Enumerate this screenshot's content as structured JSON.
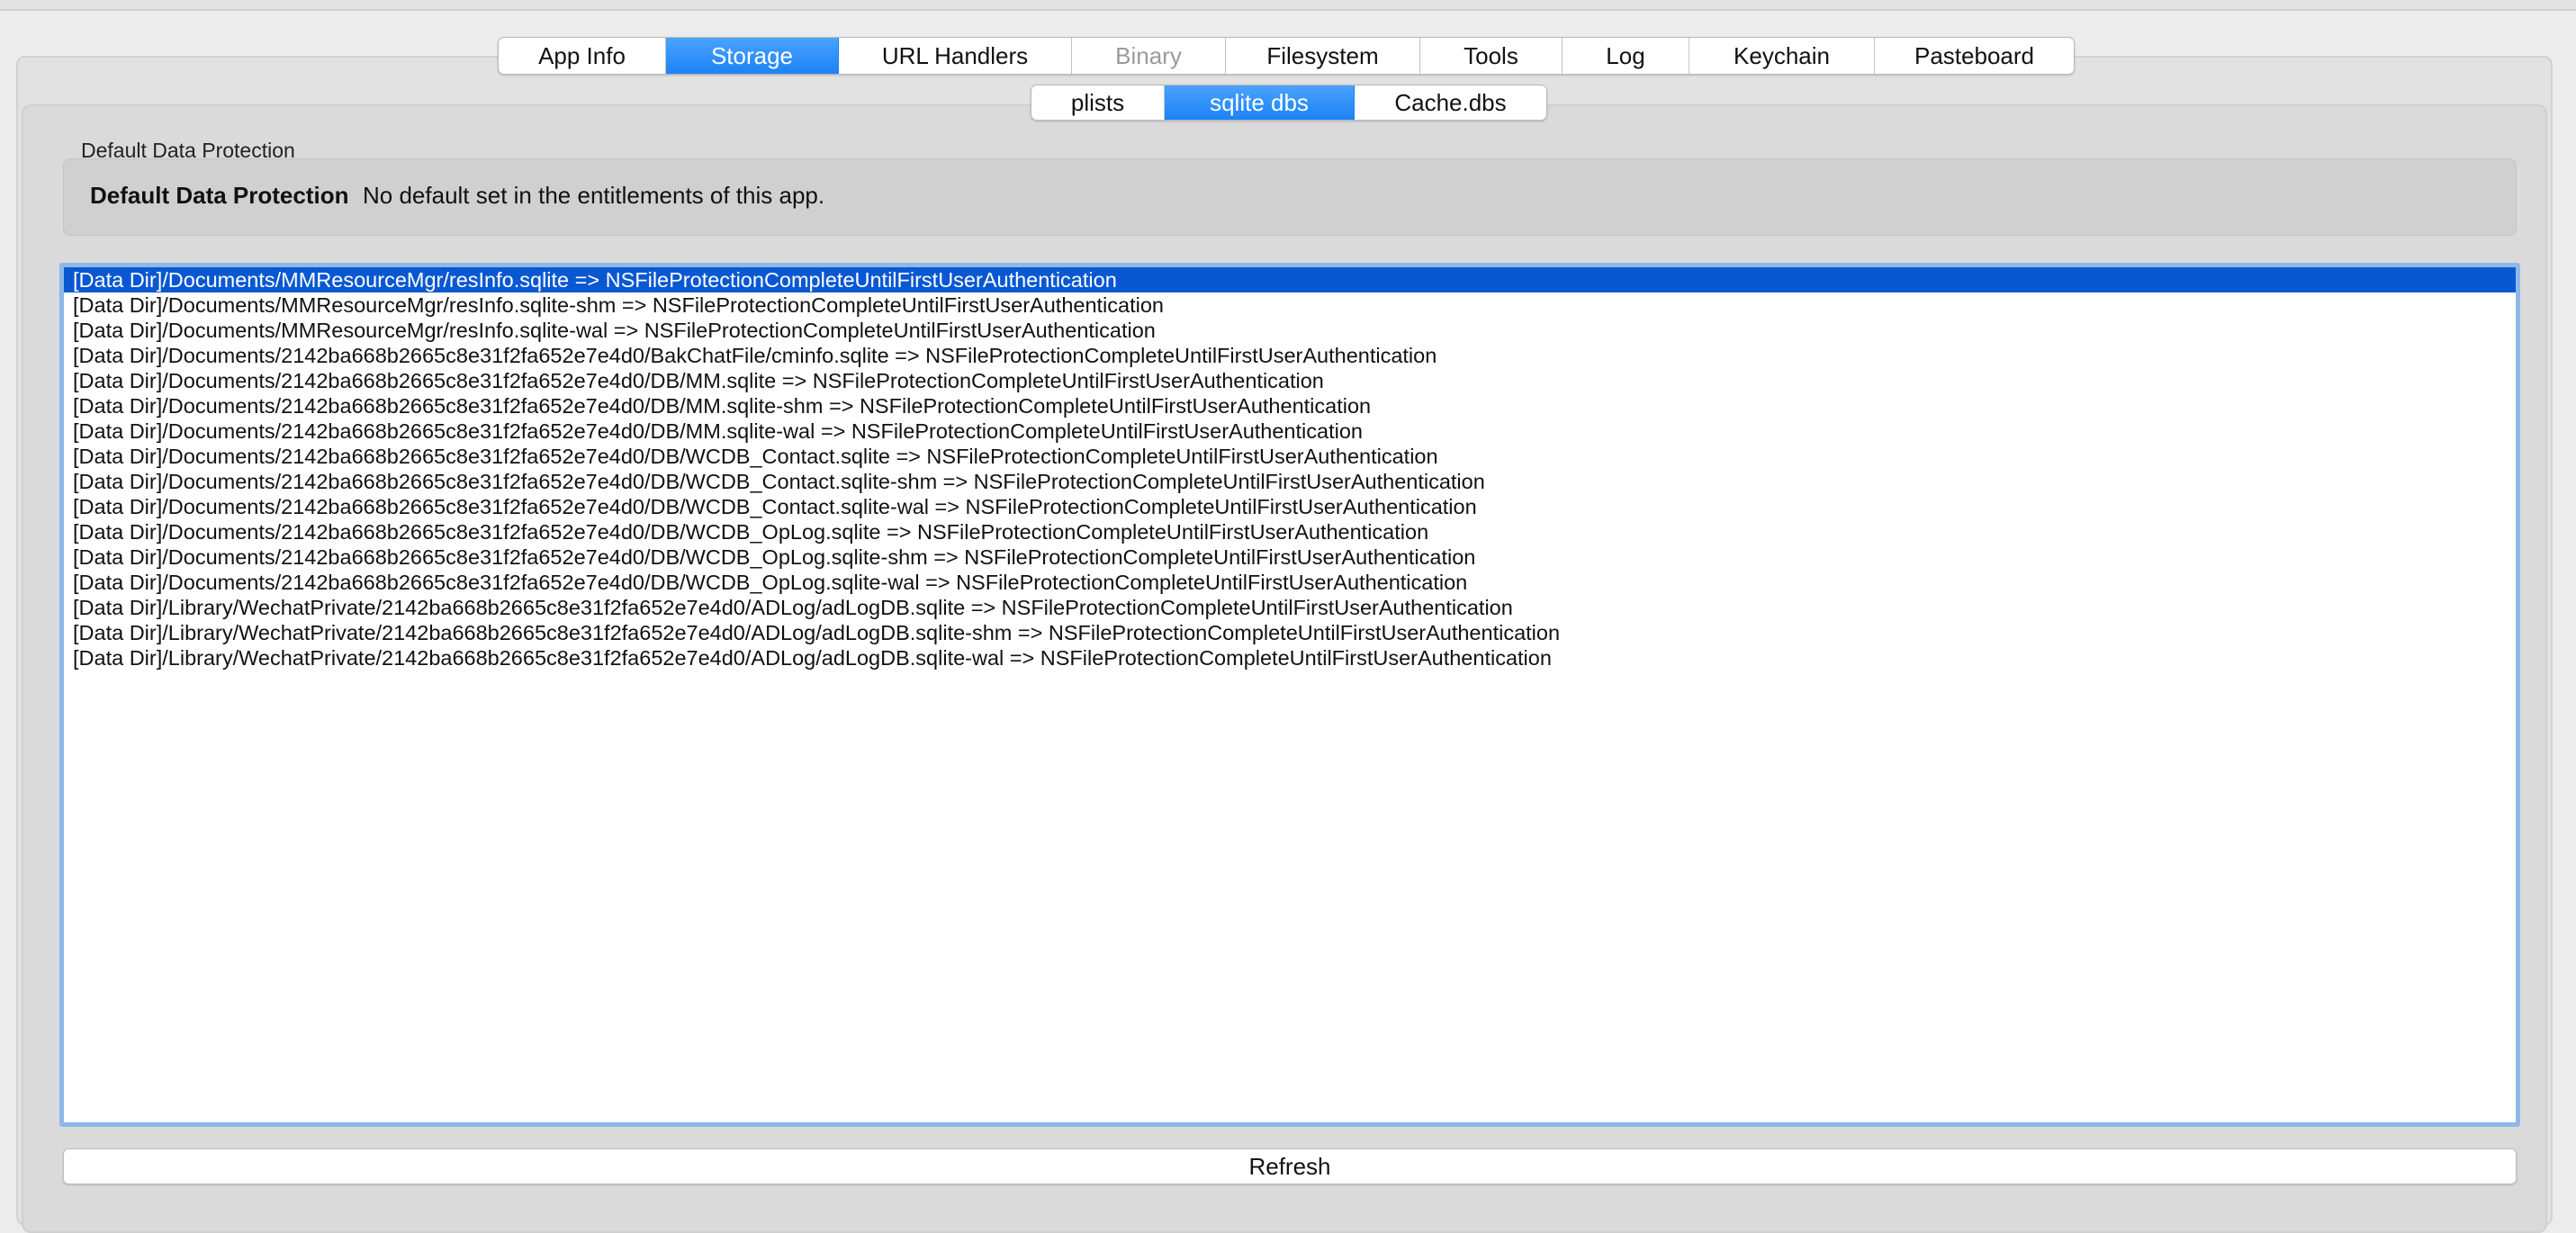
{
  "main_tabs": [
    {
      "label": "App Info",
      "state": "normal"
    },
    {
      "label": "Storage",
      "state": "active"
    },
    {
      "label": "URL Handlers",
      "state": "normal"
    },
    {
      "label": "Binary",
      "state": "disabled"
    },
    {
      "label": "Filesystem",
      "state": "normal"
    },
    {
      "label": "Tools",
      "state": "normal"
    },
    {
      "label": "Log",
      "state": "normal"
    },
    {
      "label": "Keychain",
      "state": "normal"
    },
    {
      "label": "Pasteboard",
      "state": "normal"
    }
  ],
  "sub_tabs": [
    {
      "label": "plists",
      "state": "normal"
    },
    {
      "label": "sqlite dbs",
      "state": "active"
    },
    {
      "label": "Cache.dbs",
      "state": "normal"
    }
  ],
  "data_protection": {
    "group_title": "Default Data Protection",
    "key_label": "Default Data Protection",
    "value": "No default set in the entitlements of this app."
  },
  "files": [
    "[Data Dir]/Documents/MMResourceMgr/resInfo.sqlite => NSFileProtectionCompleteUntilFirstUserAuthentication",
    "[Data Dir]/Documents/MMResourceMgr/resInfo.sqlite-shm => NSFileProtectionCompleteUntilFirstUserAuthentication",
    "[Data Dir]/Documents/MMResourceMgr/resInfo.sqlite-wal => NSFileProtectionCompleteUntilFirstUserAuthentication",
    "[Data Dir]/Documents/2142ba668b2665c8e31f2fa652e7e4d0/BakChatFile/cminfo.sqlite => NSFileProtectionCompleteUntilFirstUserAuthentication",
    "[Data Dir]/Documents/2142ba668b2665c8e31f2fa652e7e4d0/DB/MM.sqlite => NSFileProtectionCompleteUntilFirstUserAuthentication",
    "[Data Dir]/Documents/2142ba668b2665c8e31f2fa652e7e4d0/DB/MM.sqlite-shm => NSFileProtectionCompleteUntilFirstUserAuthentication",
    "[Data Dir]/Documents/2142ba668b2665c8e31f2fa652e7e4d0/DB/MM.sqlite-wal => NSFileProtectionCompleteUntilFirstUserAuthentication",
    "[Data Dir]/Documents/2142ba668b2665c8e31f2fa652e7e4d0/DB/WCDB_Contact.sqlite => NSFileProtectionCompleteUntilFirstUserAuthentication",
    "[Data Dir]/Documents/2142ba668b2665c8e31f2fa652e7e4d0/DB/WCDB_Contact.sqlite-shm => NSFileProtectionCompleteUntilFirstUserAuthentication",
    "[Data Dir]/Documents/2142ba668b2665c8e31f2fa652e7e4d0/DB/WCDB_Contact.sqlite-wal => NSFileProtectionCompleteUntilFirstUserAuthentication",
    "[Data Dir]/Documents/2142ba668b2665c8e31f2fa652e7e4d0/DB/WCDB_OpLog.sqlite => NSFileProtectionCompleteUntilFirstUserAuthentication",
    "[Data Dir]/Documents/2142ba668b2665c8e31f2fa652e7e4d0/DB/WCDB_OpLog.sqlite-shm => NSFileProtectionCompleteUntilFirstUserAuthentication",
    "[Data Dir]/Documents/2142ba668b2665c8e31f2fa652e7e4d0/DB/WCDB_OpLog.sqlite-wal => NSFileProtectionCompleteUntilFirstUserAuthentication",
    "[Data Dir]/Library/WechatPrivate/2142ba668b2665c8e31f2fa652e7e4d0/ADLog/adLogDB.sqlite => NSFileProtectionCompleteUntilFirstUserAuthentication",
    "[Data Dir]/Library/WechatPrivate/2142ba668b2665c8e31f2fa652e7e4d0/ADLog/adLogDB.sqlite-shm => NSFileProtectionCompleteUntilFirstUserAuthentication",
    "[Data Dir]/Library/WechatPrivate/2142ba668b2665c8e31f2fa652e7e4d0/ADLog/adLogDB.sqlite-wal => NSFileProtectionCompleteUntilFirstUserAuthentication"
  ],
  "selected_index": 0,
  "refresh_label": "Refresh",
  "colors": {
    "accent": "#1c82f5",
    "selection": "#0a58d1",
    "focus_ring": "#8db8e8"
  }
}
